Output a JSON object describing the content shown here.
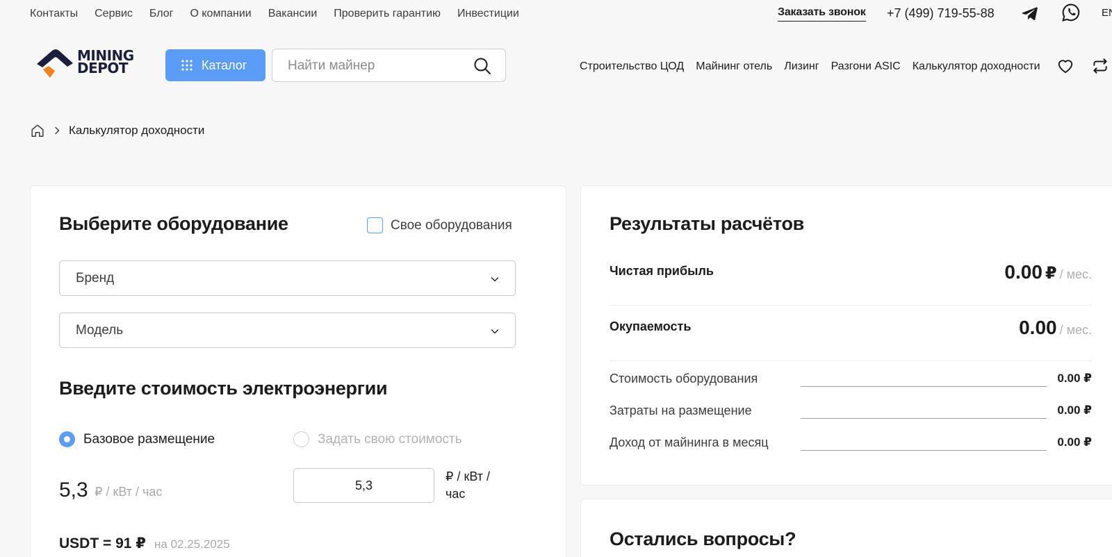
{
  "topbar": {
    "links": [
      "Контакты",
      "Сервис",
      "Блог",
      "О компании",
      "Вакансии",
      "Проверить гарантию",
      "Инвестиции"
    ],
    "callback": "Заказать звонок",
    "phone": "+7 (499) 719-55-88",
    "lang": "EN"
  },
  "header": {
    "logo_line1": "MINING",
    "logo_line2": "DEPOT",
    "catalog_label": "Каталог",
    "search_placeholder": "Найти майнер",
    "nav": [
      "Строительство ЦОД",
      "Майнинг отель",
      "Лизинг",
      "Разгони ASIC",
      "Калькулятор доходности"
    ]
  },
  "breadcrumb": {
    "current": "Калькулятор доходности"
  },
  "equipment": {
    "title": "Выберите оборудование",
    "custom_label": "Свое оборудования",
    "brand_placeholder": "Бренд",
    "model_placeholder": "Модель"
  },
  "electricity": {
    "title": "Введите стоимость электроэнергии",
    "option_base": "Базовое размещение",
    "option_custom": "Задать свою стоимость",
    "base_price": "5,3",
    "base_unit": "₽ / кВт / час",
    "input_value": "5,3",
    "input_unit": "₽ / кВт / час",
    "usdt_label": "USDT = 91 ₽",
    "usdt_date": "на 02.25.2025"
  },
  "results": {
    "title": "Результаты расчётов",
    "net_profit_label": "Чистая прибыль",
    "net_profit_value": "0.00",
    "net_profit_currency": "₽",
    "net_profit_period": "/ мес.",
    "payback_label": "Окупаемость",
    "payback_value": "0.00",
    "payback_period": "/ мес.",
    "lines": [
      {
        "label": "Стоимость оборудования",
        "value": "0.00 ₽"
      },
      {
        "label": "Затраты на размещение",
        "value": "0.00 ₽"
      },
      {
        "label": "Доход от майнинга в месяц",
        "value": "0.00 ₽"
      }
    ]
  },
  "questions": {
    "title": "Остались вопросы?"
  },
  "colors": {
    "accent": "#5b9cf6",
    "logo_navy": "#1a1f3c",
    "logo_orange": "#f5821f"
  }
}
